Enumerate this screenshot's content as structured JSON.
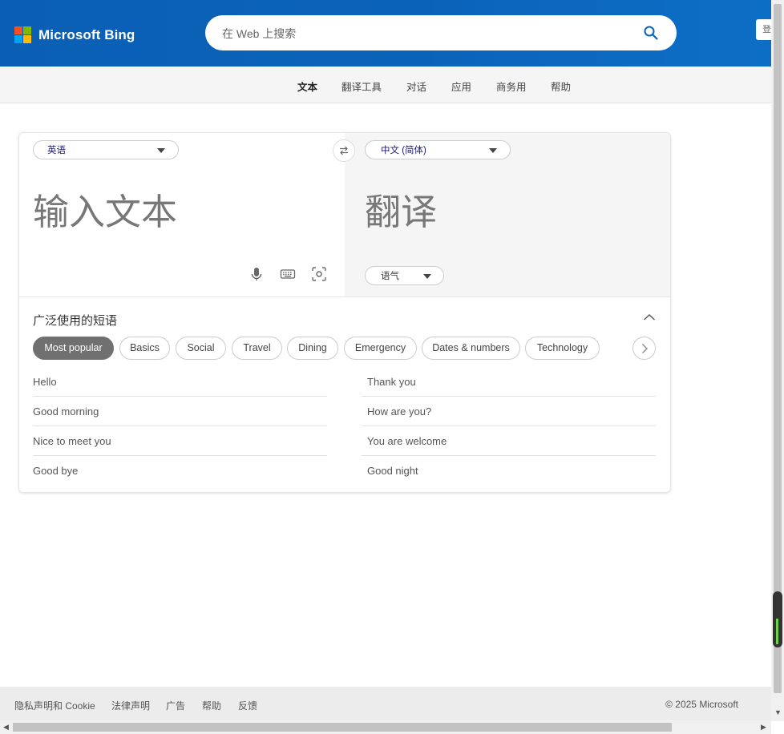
{
  "header": {
    "brand": "Microsoft Bing",
    "search_placeholder": "在 Web 上搜索",
    "signin_label": "登录"
  },
  "nav": {
    "items": [
      "文本",
      "翻译工具",
      "对话",
      "应用",
      "商务用",
      "帮助"
    ],
    "active": "文本"
  },
  "translator": {
    "source_lang": "英语",
    "target_lang": "中文 (简体)",
    "input_placeholder": "输入文本",
    "output_placeholder": "翻译",
    "tone_label": "语气"
  },
  "phrases": {
    "title": "广泛使用的短语",
    "categories": [
      "Most popular",
      "Basics",
      "Social",
      "Travel",
      "Dining",
      "Emergency",
      "Dates & numbers",
      "Technology"
    ],
    "active_category": "Most popular",
    "left": [
      "Hello",
      "Good morning",
      "Nice to meet you",
      "Good bye"
    ],
    "right": [
      "Thank you",
      "How are you?",
      "You are welcome",
      "Good night"
    ]
  },
  "footer": {
    "links": [
      "隐私声明和 Cookie",
      "法律声明",
      "广告",
      "帮助",
      "反馈"
    ],
    "copyright": "© 2025 Microsoft"
  },
  "colors": {
    "header_blue": "#0b63b9",
    "logo_red": "#f25022",
    "logo_green": "#7fba00",
    "logo_blue": "#00a4ef",
    "logo_yellow": "#ffb900",
    "chip_active": "#707070"
  }
}
